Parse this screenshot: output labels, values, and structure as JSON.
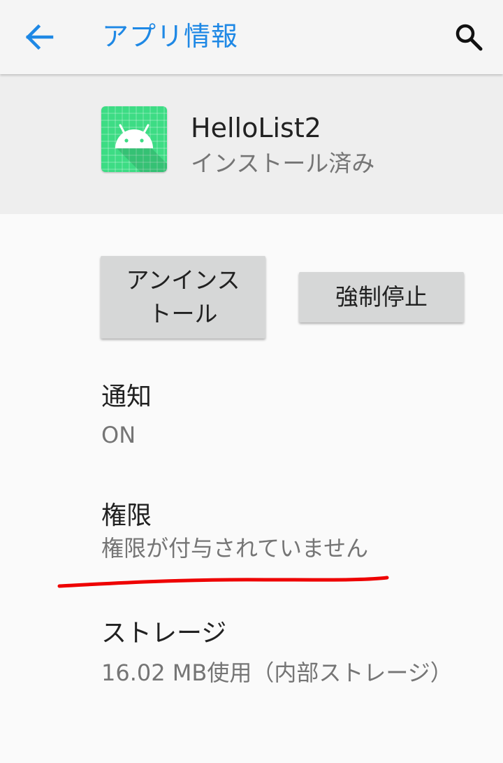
{
  "app_bar": {
    "title": "アプリ情報",
    "back_icon": "arrow-back-icon",
    "search_icon": "search-icon"
  },
  "app": {
    "name": "HelloList2",
    "status": "インストール済み",
    "icon": "android-icon"
  },
  "buttons": {
    "uninstall": "アンインストール",
    "force_stop": "強制停止"
  },
  "preferences": [
    {
      "title": "通知",
      "summary": "ON"
    },
    {
      "title": "権限",
      "summary": "権限が付与されていません"
    },
    {
      "title": "ストレージ",
      "summary": "16.02 MB使用（内部ストレージ）"
    }
  ],
  "colors": {
    "accent": "#1e88e5",
    "annotation": "#ee0000",
    "app_icon": "#3ddc84"
  }
}
